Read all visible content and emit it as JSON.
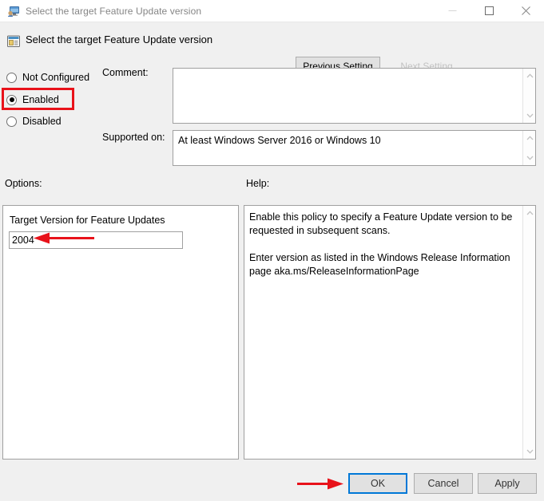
{
  "window": {
    "title": "Select the target Feature Update version",
    "icon": "policy-monitor-icon",
    "controls": {
      "minimize": "minimize-icon",
      "maximize": "maximize-icon",
      "close": "close-icon"
    }
  },
  "header": {
    "icon": "group-policy-setting-icon",
    "title": "Select the target Feature Update version",
    "previous_setting_label": "Previous Setting",
    "next_setting_label": "Next Setting",
    "next_setting_disabled": true
  },
  "state": {
    "options": [
      {
        "id": "not-configured",
        "label": "Not Configured",
        "selected": false
      },
      {
        "id": "enabled",
        "label": "Enabled",
        "selected": true
      },
      {
        "id": "disabled",
        "label": "Disabled",
        "selected": false
      }
    ],
    "highlight_color": "#e8121a"
  },
  "comment": {
    "label": "Comment:",
    "value": "",
    "placeholder": ""
  },
  "supported_on": {
    "label": "Supported on:",
    "value": "At least Windows Server 2016 or Windows 10"
  },
  "options_panel": {
    "label": "Options:",
    "field_label": "Target Version for Feature Updates",
    "field_value": "2004",
    "field_placeholder": ""
  },
  "help_panel": {
    "label": "Help:",
    "text": "Enable this policy to specify a Feature Update version to be requested in subsequent scans.\n\nEnter version as listed in the Windows Release Information page aka.ms/ReleaseInformationPage"
  },
  "footer": {
    "ok_label": "OK",
    "cancel_label": "Cancel",
    "apply_label": "Apply",
    "focused_button": "OK",
    "focus_color": "#0078d7"
  },
  "annotations": [
    {
      "name": "arrow-to-target-version-field",
      "direction": "left",
      "color": "#e8121a"
    },
    {
      "name": "arrow-to-ok-button",
      "direction": "right",
      "color": "#e8121a"
    }
  ]
}
